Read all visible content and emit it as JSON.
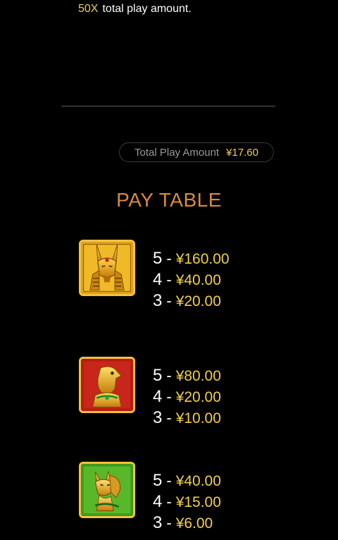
{
  "intro": {
    "multiplier": "50X",
    "text": "total play amount."
  },
  "total": {
    "label": "Total Play Amount",
    "value": "¥17.60"
  },
  "paytable": {
    "title": "PAY TABLE",
    "symbols": [
      {
        "icon": "anubis-icon",
        "lines": [
          {
            "count": "5",
            "dash": "-",
            "amount": "¥160.00"
          },
          {
            "count": "4",
            "dash": "-",
            "amount": "¥40.00"
          },
          {
            "count": "3",
            "dash": "-",
            "amount": "¥20.00"
          }
        ]
      },
      {
        "icon": "horus-falcon-icon",
        "lines": [
          {
            "count": "5",
            "dash": "-",
            "amount": "¥80.00"
          },
          {
            "count": "4",
            "dash": "-",
            "amount": "¥20.00"
          },
          {
            "count": "3",
            "dash": "-",
            "amount": "¥10.00"
          }
        ]
      },
      {
        "icon": "bastet-cat-icon",
        "lines": [
          {
            "count": "5",
            "dash": "-",
            "amount": "¥40.00"
          },
          {
            "count": "4",
            "dash": "-",
            "amount": "¥15.00"
          },
          {
            "count": "3",
            "dash": "-",
            "amount": "¥6.00"
          }
        ]
      }
    ]
  },
  "colors": {
    "gold": "#f2cf47",
    "title": "#d88b3c",
    "red_tile": "#b31812",
    "green_tile": "#3e9a1c"
  }
}
